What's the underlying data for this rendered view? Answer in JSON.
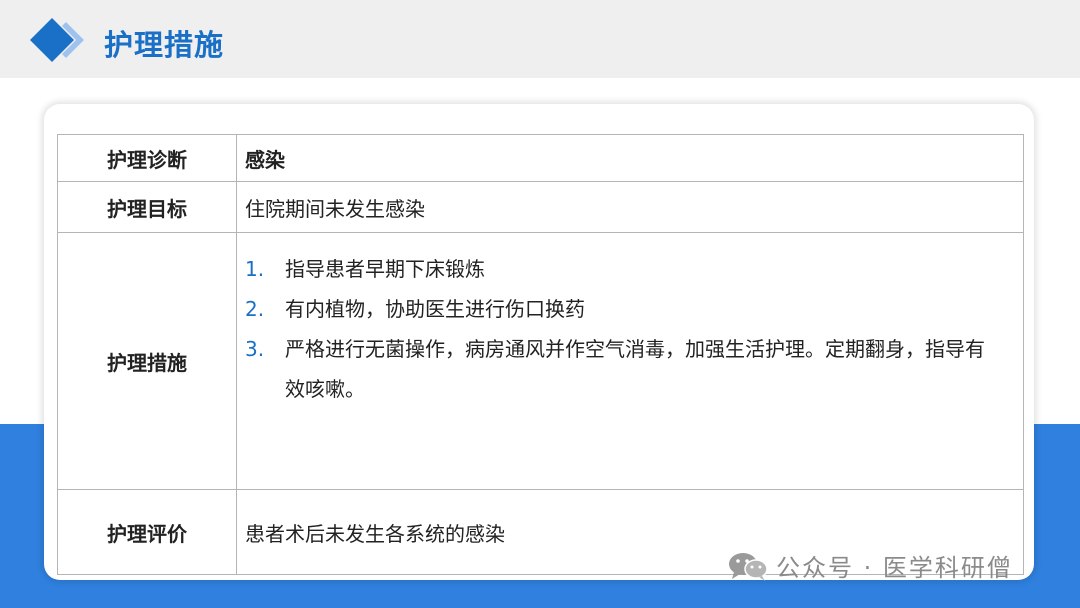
{
  "page": {
    "title": "护理措施"
  },
  "colors": {
    "accent": "#1a6fc7",
    "band": "#2f80df",
    "header": "#efefef"
  },
  "table": {
    "diagnosis": {
      "label": "护理诊断",
      "value": "感染"
    },
    "goal": {
      "label": "护理目标",
      "value": "住院期间未发生感染"
    },
    "measures": {
      "label": "护理措施",
      "items": [
        {
          "num": "1.",
          "text": "指导患者早期下床锻炼"
        },
        {
          "num": "2.",
          "text": "有内植物，协助医生进行伤口换药"
        },
        {
          "num": "3.",
          "text": "严格进行无菌操作，病房通风并作空气消毒，加强生活护理。定期翻身，指导有效咳嗽。"
        }
      ]
    },
    "evaluation": {
      "label": "护理评价",
      "value": "患者术后未发生各系统的感染"
    }
  },
  "watermark": {
    "icon": "wechat-icon",
    "text": "公众号 · 医学科研僧"
  }
}
